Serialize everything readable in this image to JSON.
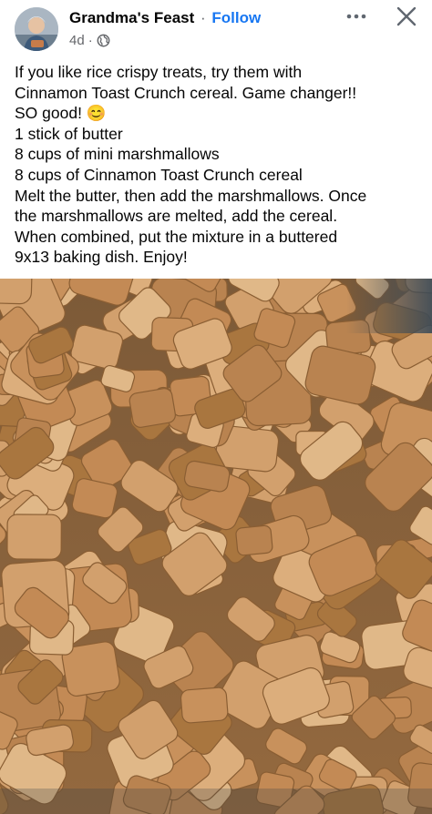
{
  "post": {
    "author": "Grandma's Feast",
    "separator": "·",
    "follow_label": "Follow",
    "time": "4d",
    "meta_separator": "·",
    "privacy_icon": "globe-icon",
    "more_icon": "more-icon",
    "close_icon": "close-icon",
    "emoji": "😊",
    "text_lines": [
      "If you like rice crispy treats, try them with",
      "Cinnamon Toast Crunch cereal. Game changer!!",
      "SO good!",
      "1 stick of butter",
      "8 cups of mini marshmallows",
      "8 cups of Cinnamon Toast Crunch cereal",
      "Melt the butter, then add the marshmallows. Once",
      "the marshmallows are melted, add the cereal.",
      "When combined, put the mixture in a buttered",
      "9x13 baking dish. Enjoy!"
    ]
  },
  "colors": {
    "follow": "#1877f2",
    "secondary_text": "#65676b",
    "cereal": "#c9935f",
    "dish_edge": "#3a4a58"
  }
}
